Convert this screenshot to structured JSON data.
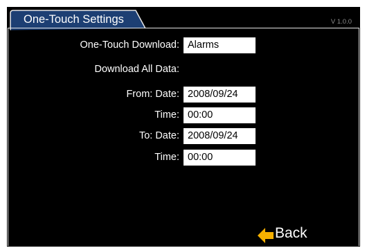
{
  "header": {
    "tab_title": "One-Touch Settings",
    "version": "V 1.0.0"
  },
  "settings": {
    "one_touch_download": {
      "label": "One-Touch Download:",
      "value": "Alarms"
    },
    "download_all_data": {
      "label": "Download All Data:"
    },
    "from_date": {
      "label": "From: Date:",
      "value": "2008/09/24"
    },
    "from_time": {
      "label": "Time:",
      "value": "00:00"
    },
    "to_date": {
      "label": "To: Date:",
      "value": "2008/09/24"
    },
    "to_time": {
      "label": "Time:",
      "value": "00:00"
    }
  },
  "footer": {
    "back_label": "Back",
    "back_icon": "left-arrow-icon"
  },
  "colors": {
    "background": "#000000",
    "tab_fill": "#1d3f73",
    "text": "#ffffff",
    "field_background": "#ffffff",
    "arrow": "#f5b000"
  }
}
